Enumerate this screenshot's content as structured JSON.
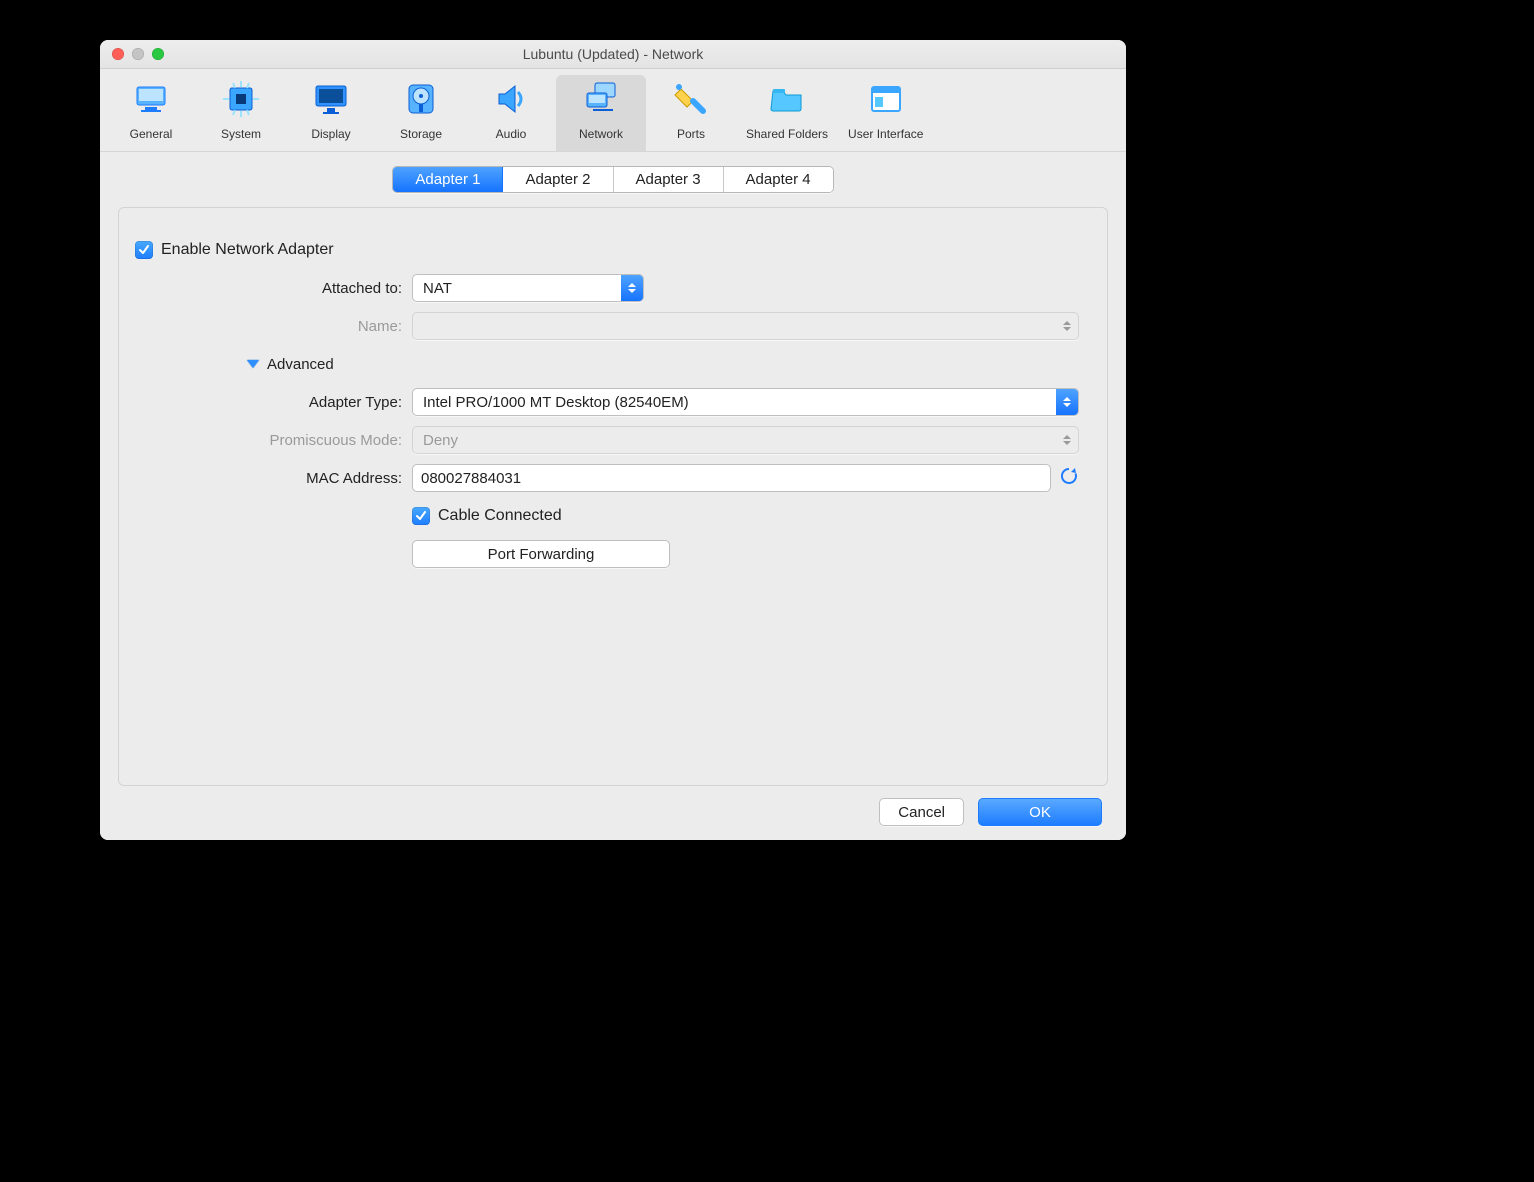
{
  "window": {
    "title": "Lubuntu (Updated) - Network"
  },
  "toolbar": [
    {
      "id": "general",
      "label": "General"
    },
    {
      "id": "system",
      "label": "System"
    },
    {
      "id": "display",
      "label": "Display"
    },
    {
      "id": "storage",
      "label": "Storage"
    },
    {
      "id": "audio",
      "label": "Audio"
    },
    {
      "id": "network",
      "label": "Network",
      "selected": true
    },
    {
      "id": "ports",
      "label": "Ports"
    },
    {
      "id": "shared_folders",
      "label": "Shared Folders"
    },
    {
      "id": "user_interface",
      "label": "User Interface"
    }
  ],
  "tabs": [
    {
      "label": "Adapter 1",
      "active": true
    },
    {
      "label": "Adapter 2"
    },
    {
      "label": "Adapter 3"
    },
    {
      "label": "Adapter 4"
    }
  ],
  "form": {
    "enable_label": "Enable Network Adapter",
    "enable_checked": true,
    "attached_to_label": "Attached to:",
    "attached_to_value": "NAT",
    "name_label": "Name:",
    "name_value": "",
    "advanced_label": "Advanced",
    "adapter_type_label": "Adapter Type:",
    "adapter_type_value": "Intel PRO/1000 MT Desktop (82540EM)",
    "promiscuous_label": "Promiscuous Mode:",
    "promiscuous_value": "Deny",
    "mac_label": "MAC Address:",
    "mac_value": "080027884031",
    "cable_label": "Cable Connected",
    "cable_checked": true,
    "port_fwd_label": "Port Forwarding"
  },
  "footer": {
    "cancel": "Cancel",
    "ok": "OK"
  }
}
